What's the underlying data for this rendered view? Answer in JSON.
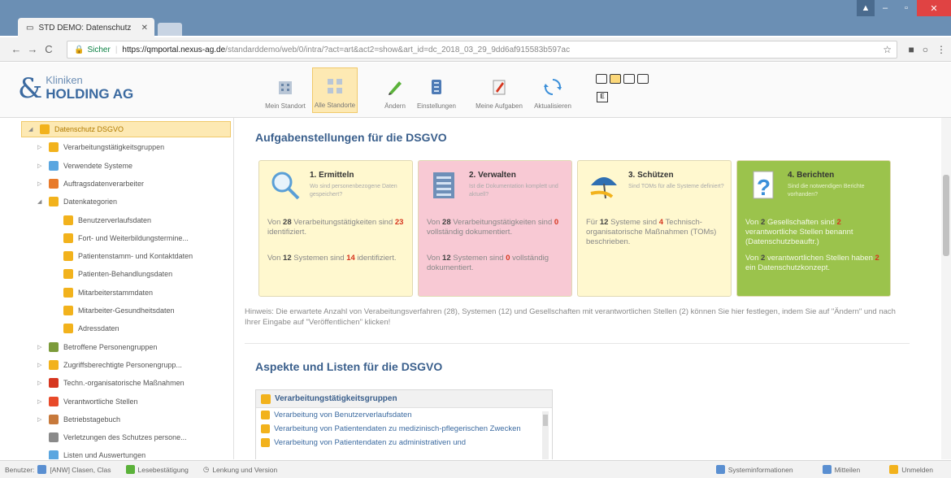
{
  "browser": {
    "tab_title": "STD DEMO: Datenschutz",
    "tab_close": "✕",
    "url_secure_label": "Sicher",
    "url_host": "https://qmportal.nexus-ag.de",
    "url_path": "/standarddemo/web/0/intra/?act=art&act2=show&art_id=dc_2018_03_29_9dd6af915583b597ac"
  },
  "app": {
    "logo_line1": "Kliniken",
    "logo_line2": "HOLDING AG",
    "toolbar": [
      {
        "label": "Mein Standort",
        "icon": "building-icon"
      },
      {
        "label": "Alle Standorte",
        "icon": "all-sites-icon",
        "active": true
      },
      {
        "label": "Ändern",
        "icon": "pencil-icon"
      },
      {
        "label": "Einstellungen",
        "icon": "settings-icon"
      },
      {
        "label": "Meine Aufgaben",
        "icon": "tasks-icon"
      },
      {
        "label": "Aktualisieren",
        "icon": "refresh-icon"
      }
    ],
    "layout_e": "E"
  },
  "sidebar": {
    "items": [
      {
        "label": "Datenschutz DSGVO",
        "level": 0,
        "arrow": "◢",
        "selected": true,
        "icon_color": "#f2b21c"
      },
      {
        "label": "Verarbeitungstätigkeitsgruppen",
        "level": 1,
        "arrow": "▷",
        "icon_color": "#f2b21c"
      },
      {
        "label": "Verwendete Systeme",
        "level": 1,
        "arrow": "▷",
        "icon_color": "#5aa6e0"
      },
      {
        "label": "Auftragsdatenverarbeiter",
        "level": 1,
        "arrow": "▷",
        "icon_color": "#e87a2a"
      },
      {
        "label": "Datenkategorien",
        "level": 1,
        "arrow": "◢",
        "icon_color": "#f2b21c"
      },
      {
        "label": "Benutzerverlaufsdaten",
        "level": 2,
        "arrow": "",
        "icon_color": "#f2b21c"
      },
      {
        "label": "Fort- und Weiterbildungstermine...",
        "level": 2,
        "arrow": "",
        "icon_color": "#f2b21c"
      },
      {
        "label": "Patientenstamm- und Kontaktdaten",
        "level": 2,
        "arrow": "",
        "icon_color": "#f2b21c"
      },
      {
        "label": "Patienten-Behandlungsdaten",
        "level": 2,
        "arrow": "",
        "icon_color": "#f2b21c"
      },
      {
        "label": "Mitarbeiterstammdaten",
        "level": 2,
        "arrow": "",
        "icon_color": "#f2b21c"
      },
      {
        "label": "Mitarbeiter-Gesundheitsdaten",
        "level": 2,
        "arrow": "",
        "icon_color": "#f2b21c"
      },
      {
        "label": "Adressdaten",
        "level": 2,
        "arrow": "",
        "icon_color": "#f2b21c"
      },
      {
        "label": "Betroffene Personengruppen",
        "level": 1,
        "arrow": "▷",
        "icon_color": "#7c9b3a"
      },
      {
        "label": "Zugriffsberechtigte Personengrupp...",
        "level": 1,
        "arrow": "▷",
        "icon_color": "#f2b21c"
      },
      {
        "label": "Techn.-organisatorische Maßnahmen",
        "level": 1,
        "arrow": "▷",
        "icon_color": "#d6361f"
      },
      {
        "label": "Verantwortliche Stellen",
        "level": 1,
        "arrow": "▷",
        "icon_color": "#e84a2a"
      },
      {
        "label": "Betriebstagebuch",
        "level": 1,
        "arrow": "▷",
        "icon_color": "#c7793b"
      },
      {
        "label": "Verletzungen des Schutzes persone...",
        "level": 1,
        "arrow": "",
        "icon_color": "#8a8a8a"
      },
      {
        "label": "Listen und Auswertungen",
        "level": 1,
        "arrow": "",
        "icon_color": "#5aa6e0"
      }
    ]
  },
  "main": {
    "section1_title": "Aufgabenstellungen für die DSGVO",
    "cards": [
      {
        "title": "1. Ermitteln",
        "subtitle": "Wo sind personenbezogene Daten gespeichert?",
        "bg": "#fff8cf",
        "icon": "magnifier-icon",
        "p1a": "Von ",
        "p1n": "28",
        "p1b": " Verarbeitungstätigkeiten sind ",
        "p1m": "23",
        "p1c": " identifiziert.",
        "p2a": "Von ",
        "p2n": "12",
        "p2b": " Systemen sind ",
        "p2m": "14",
        "p2c": " identifiziert."
      },
      {
        "title": "2. Verwalten",
        "subtitle": "Ist die Dokumentation komplett und aktuell?",
        "bg": "#f8c9d4",
        "icon": "server-icon",
        "p1a": "Von ",
        "p1n": "28",
        "p1b": " Verarbeitungstätigkeiten sind ",
        "p1m": "0",
        "p1c": " vollständig dokumentiert.",
        "p2a": "Von ",
        "p2n": "12",
        "p2b": " Systemen sind ",
        "p2m": "0",
        "p2c": " vollständig dokumentiert."
      },
      {
        "title": "3. Schützen",
        "subtitle": "Sind TOMs für alle Systeme definiert?",
        "bg": "#fff8cf",
        "icon": "umbrella-icon",
        "p1a": "Für ",
        "p1n": "12",
        "p1b": " Systeme sind ",
        "p1m": "4",
        "p1c": " Technisch-organisatorische Maßnahmen (TOMs) beschrieben.",
        "p2a": "",
        "p2n": "",
        "p2b": "",
        "p2m": "",
        "p2c": ""
      },
      {
        "title": "4. Berichten",
        "subtitle": "Sind die notwendigen Berichte vorhanden?",
        "bg": "#9bc34c",
        "icon": "document-question-icon",
        "p1a": "Von ",
        "p1n": "2",
        "p1b": " Gesellschaften sind ",
        "p1m": "2",
        "p1c": " verantwortliche Stellen benannt (Datenschutzbeauftr.)",
        "p2a": "Von ",
        "p2n": "2",
        "p2b": " verantwortlichen Stellen haben ",
        "p2m": "2",
        "p2c": " ein Datenschutzkonzept."
      }
    ],
    "hint": "Hinweis: Die erwartete Anzahl von Verabeitungsverfahren (28), Systemen (12) und Gesellschaften mit verantwortlichen Stellen (2) können Sie hier festlegen, indem Sie auf \"Ändern\" und nach Ihrer Eingabe auf \"Veröffentlichen\" klicken!",
    "section2_title": "Aspekte und Listen für die DSGVO",
    "list_title": "Verarbeitungstätigkeitsgruppen",
    "list_items": [
      "Verarbeitung von Benutzerverlaufsdaten",
      "Verarbeitung von Patientendaten zu medizinisch-pflegerischen Zwecken",
      "Verarbeitung von Patientendaten zu administrativen und"
    ]
  },
  "status": {
    "user_label": "Benutzer:",
    "user_name": "[ANW] Clasen, Clas",
    "reading": "Lesebestätigung",
    "steering": "Lenkung und Version",
    "sysinfo": "Systeminformationen",
    "notify": "Mitteilen",
    "logout": "Unmelden"
  }
}
